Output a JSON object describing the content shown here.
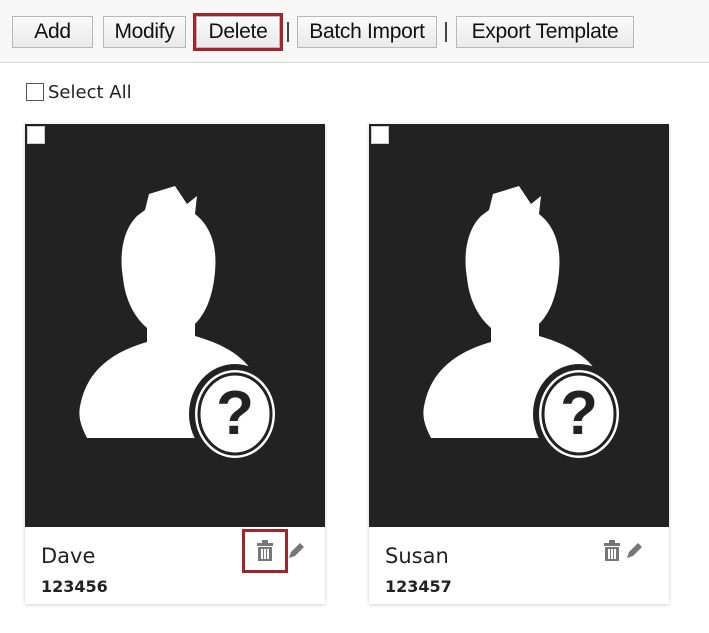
{
  "toolbar": {
    "add_label": "Add",
    "modify_label": "Modify",
    "delete_label": "Delete",
    "batch_import_label": "Batch Import",
    "export_template_label": "Export Template"
  },
  "select_all": {
    "label": "Select All",
    "checked": false
  },
  "persons": [
    {
      "name": "Dave",
      "id": "123456",
      "photo": "unknown-person-placeholder"
    },
    {
      "name": "Susan",
      "id": "123457",
      "photo": "unknown-person-placeholder"
    }
  ],
  "colors": {
    "highlight": "#a2242d",
    "photo_bg": "#222222",
    "icon_gray": "#777777"
  }
}
